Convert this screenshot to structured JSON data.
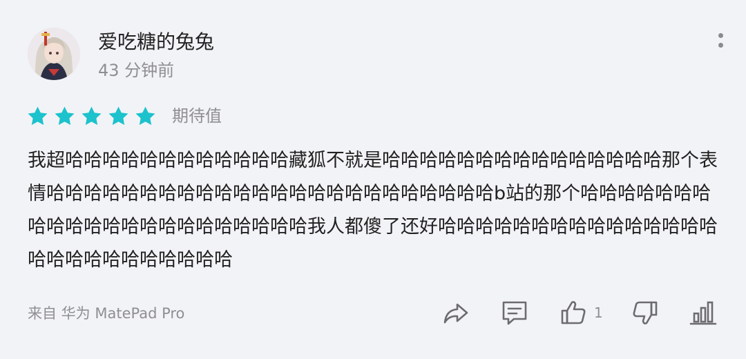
{
  "comment": {
    "username": "爱吃糖的兔兔",
    "time": "43 分钟前",
    "rating": {
      "stars": 5,
      "max": 5,
      "label": "期待值",
      "star_color": "#1cc2cc"
    },
    "text": "我超哈哈哈哈哈哈哈哈哈哈哈哈藏狐不就是哈哈哈哈哈哈哈哈哈哈哈哈哈哈哈那个表情哈哈哈哈哈哈哈哈哈哈哈哈哈哈哈哈哈哈哈哈哈哈哈哈b站的那个哈哈哈哈哈哈哈哈哈哈哈哈哈哈哈哈哈哈哈哈哈哈我人都傻了还好哈哈哈哈哈哈哈哈哈哈哈哈哈哈哈哈哈哈哈哈哈哈哈哈哈哈",
    "source": "来自 华为 MatePad Pro",
    "actions": {
      "like_count": "1"
    },
    "icons": {
      "more": "more-vertical-icon",
      "share": "share-icon",
      "reply": "comment-icon",
      "like": "thumbs-up-icon",
      "dislike": "thumbs-down-icon",
      "stats": "bar-chart-icon"
    },
    "colors": {
      "text": "#222222",
      "muted": "#8e8e93",
      "icon": "#6b6b70",
      "background": "#f2f3f7"
    }
  }
}
